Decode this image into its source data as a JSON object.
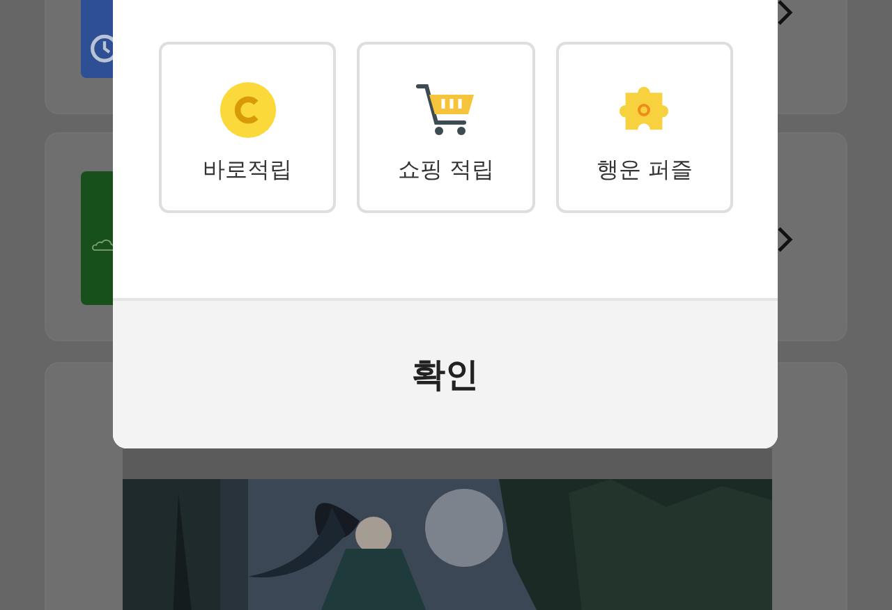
{
  "background": {
    "cards": [
      {
        "kind": "alarm"
      },
      {
        "kind": "cloud"
      },
      {
        "kind": "banner"
      }
    ]
  },
  "dialog": {
    "options": [
      {
        "label": "바로적립",
        "kind": "coin"
      },
      {
        "label": "쇼핑 적립",
        "kind": "cart"
      },
      {
        "label": "행운 퍼즐",
        "kind": "puzzle"
      }
    ],
    "confirm_button": "확인"
  }
}
